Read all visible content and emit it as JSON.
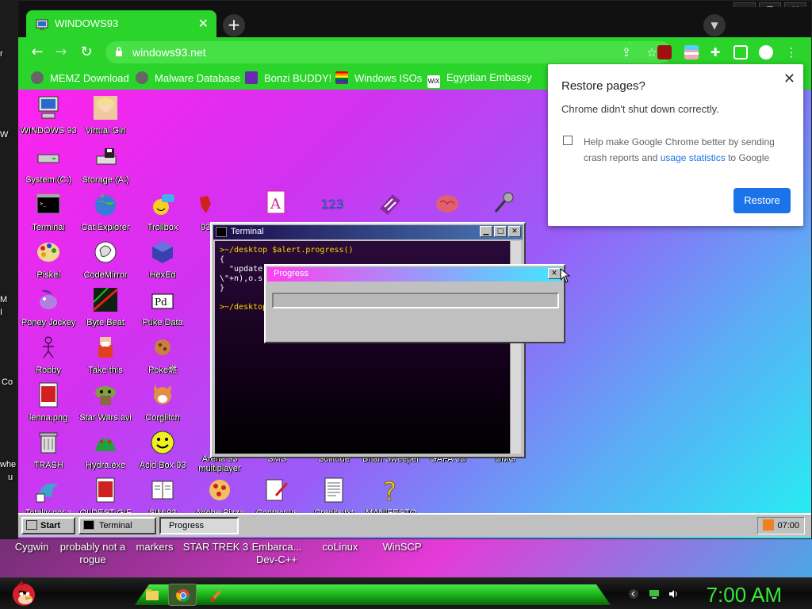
{
  "host": {
    "side_labels": [
      "r",
      "W",
      "M",
      "I",
      "Co",
      "whe",
      "u"
    ],
    "bottom_icons": [
      {
        "label": "Cygwin"
      },
      {
        "label": "probably not a rogue"
      },
      {
        "label": "markers"
      },
      {
        "label": "STAR TREK 3"
      },
      {
        "label": "Embarca... Dev-C++"
      },
      {
        "label": "coLinux"
      },
      {
        "label": "WinSCP"
      }
    ],
    "taskbar": {
      "clock": "7:00 AM"
    }
  },
  "browser": {
    "window_controls": [
      "—",
      "▢",
      "✕"
    ],
    "tab": {
      "title": "WINDOWS93",
      "close": "✕"
    },
    "new_tab": "+",
    "url": "windows93.net",
    "bookmarks": [
      {
        "label": "MEMZ Download",
        "icon": "globe-icon"
      },
      {
        "label": "Malware Database",
        "icon": "globe-icon"
      },
      {
        "label": "Bonzi BUDDY!",
        "icon": "bonzi-icon"
      },
      {
        "label": "Windows ISOs",
        "icon": "rainbow-icon"
      },
      {
        "label": "Egyptian Embassy",
        "icon": "wix-icon"
      }
    ]
  },
  "w93": {
    "icons": [
      {
        "label": "WINDOWS 93"
      },
      {
        "label": "Virtual Girl"
      },
      {
        "label": "System (C:)"
      },
      {
        "label": "Storage (A:)"
      },
      {
        "label": "Terminal"
      },
      {
        "label": "Cat Explorer"
      },
      {
        "label": "Trollbox"
      },
      {
        "label": "93"
      },
      {
        "label": "Piskel"
      },
      {
        "label": "CodeMirror"
      },
      {
        "label": "HexEd"
      },
      {
        "label": "Poney Jockey"
      },
      {
        "label": "Byte Beat"
      },
      {
        "label": "Puke Data"
      },
      {
        "label": "Robby"
      },
      {
        "label": "Take this"
      },
      {
        "label": "Poke燃"
      },
      {
        "label": "lenna.png"
      },
      {
        "label": "Star Wars.avi"
      },
      {
        "label": "Corglitch"
      },
      {
        "label": "TRASH"
      },
      {
        "label": "Hydra.exe"
      },
      {
        "label": "Acid Box 93"
      },
      {
        "label": "Arena 93 multiplayer"
      },
      {
        "label": "SMS"
      },
      {
        "label": "Solitude"
      },
      {
        "label": "Brian Sweeper"
      },
      {
        "label": "GAFA 3D"
      },
      {
        "label": "DMG"
      },
      {
        "label": "Totally not a"
      },
      {
        "label": "OLDEST GIF"
      },
      {
        "label": "SIM 93"
      },
      {
        "label": "Adobe Pizza"
      },
      {
        "label": "Contact us"
      },
      {
        "label": "Credits.txt"
      },
      {
        "label": "MANIFESTO"
      }
    ],
    "terminal": {
      "title": "Terminal",
      "line1": ">~/desktop $alert.progress()",
      "line2": "{",
      "line3": "  \"update",
      "line4": "\\\"+n),o.s",
      "line5": "}",
      "line6": ">~/desktop"
    },
    "progress": {
      "title": "Progress",
      "value": 0
    },
    "taskbar": {
      "start": "Start",
      "terminal": "Terminal",
      "progress": "Progress",
      "clock": "07:00"
    }
  },
  "restore_popup": {
    "title": "Restore pages?",
    "message": "Chrome didn't shut down correctly.",
    "checkbox_pre": "Help make Google Chrome better by sending crash reports and ",
    "checkbox_link": "usage statistics",
    "checkbox_post": " to Google",
    "button": "Restore"
  },
  "colors": {
    "chrome_accent": "#2ad42a",
    "restore_button": "#1a73e8",
    "host_clock": "#38e838"
  }
}
